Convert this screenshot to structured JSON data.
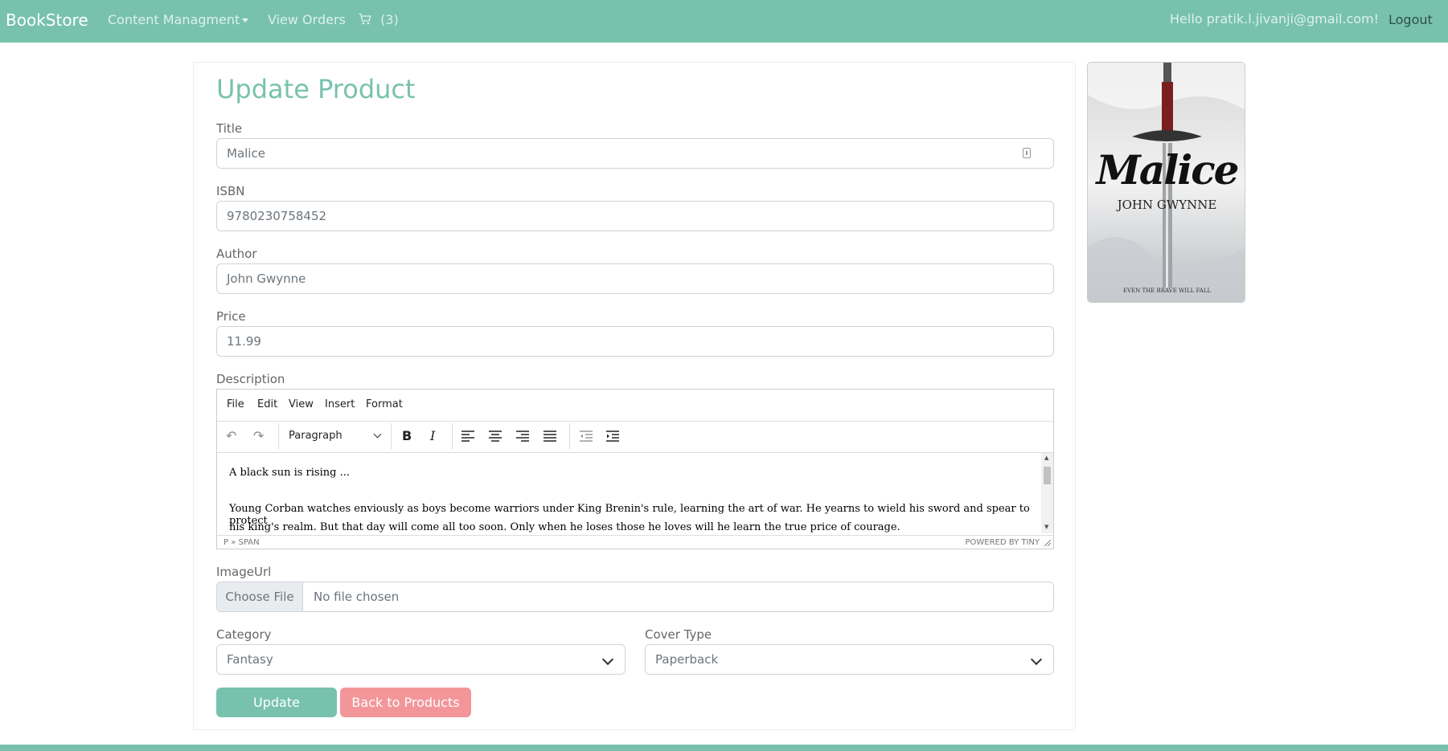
{
  "navbar": {
    "brand": "BookStore",
    "content_management": "Content Managment",
    "view_orders": "View Orders",
    "cart_count": "(3)",
    "greeting": "Hello pratik.l.jivanji@gmail.com!",
    "logout": "Logout"
  },
  "form": {
    "title": "Update Product",
    "fields": {
      "title": {
        "label": "Title",
        "value": "Malice"
      },
      "isbn": {
        "label": "ISBN",
        "value": "9780230758452"
      },
      "author": {
        "label": "Author",
        "value": "John Gwynne"
      },
      "price": {
        "label": "Price",
        "value": "11.99"
      }
    },
    "description": {
      "label": "Description",
      "menus": [
        "File",
        "Edit",
        "View",
        "Insert",
        "Format"
      ],
      "block_format": "Paragraph",
      "paragraph1": "A black sun is rising ...",
      "paragraph2_line1": "Young Corban watches enviously as boys become warriors under King Brenin's rule, learning the art of war. He yearns to wield his sword and spear to protect",
      "paragraph2_line2": "his king's realm. But that day will come all too soon. Only when he loses those he loves will he learn the true price of courage.",
      "status_path": "P » SPAN",
      "powered_by": "POWERED BY TINY"
    },
    "image_url": {
      "label": "ImageUrl",
      "button": "Choose File",
      "status": "No file chosen"
    },
    "category": {
      "label": "Category",
      "value": "Fantasy"
    },
    "cover_type": {
      "label": "Cover Type",
      "value": "Paperback"
    },
    "update_button": "Update",
    "back_button": "Back to Products"
  },
  "cover": {
    "title": "Malice",
    "author": "JOHN GWYNNE",
    "tagline": "EVEN THE BRAVE WILL FALL"
  },
  "colors": {
    "primary": "#78c2ad",
    "secondary": "#f3969a"
  }
}
